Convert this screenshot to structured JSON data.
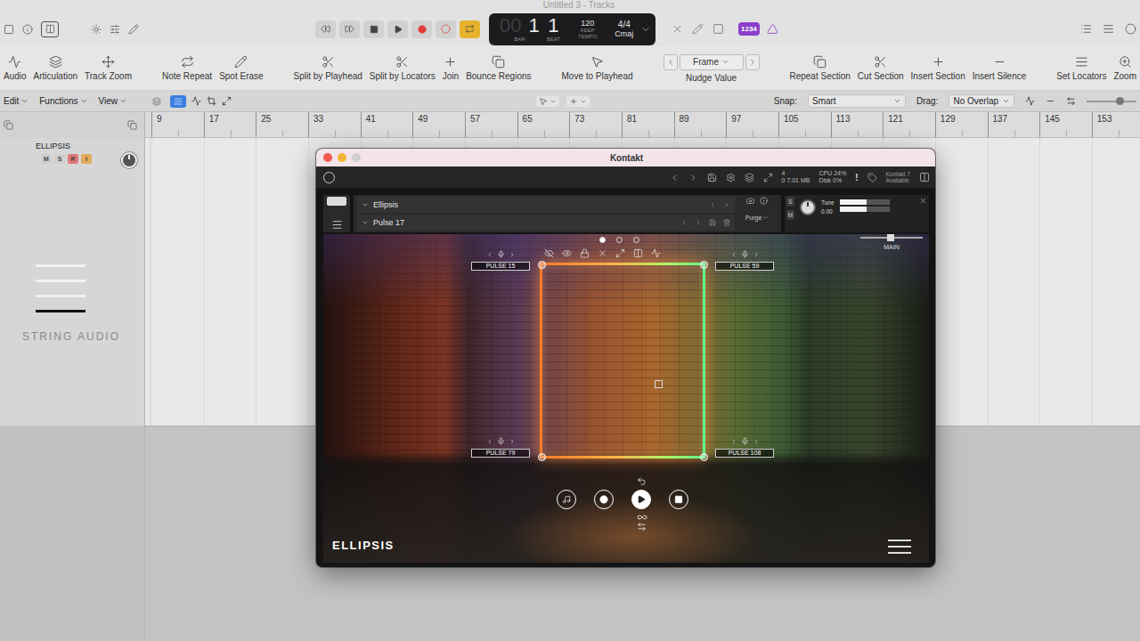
{
  "window": {
    "title": "Untitled 3 - Tracks"
  },
  "transport": {
    "bar_prefix": "00",
    "bar": "1",
    "beat": "1",
    "bar_label": "BAR",
    "beat_label": "BEAT",
    "tempo": "120",
    "tempo_mode": "KEEP",
    "tempo_label": "TEMPO",
    "signature": "4/4",
    "key": "Cmaj",
    "cycle_on": true,
    "count_in": "1234"
  },
  "toolbar": {
    "left": [
      [
        {
          "label": "Audio"
        },
        {
          "label": "Articulation"
        },
        {
          "label": "Track Zoom"
        }
      ],
      [
        {
          "label": "Note Repeat"
        },
        {
          "label": "Spot Erase"
        }
      ],
      [
        {
          "label": "Split by Playhead"
        },
        {
          "label": "Split by Locators"
        },
        {
          "label": "Join"
        },
        {
          "label": "Bounce Regions"
        }
      ],
      [
        {
          "label": "Move to Playhead"
        }
      ]
    ],
    "nudge": {
      "value": "Frame",
      "label": "Nudge Value"
    },
    "right": [
      [
        {
          "label": "Repeat Section"
        },
        {
          "label": "Cut Section"
        },
        {
          "label": "Insert Section"
        },
        {
          "label": "Insert Silence"
        }
      ],
      [
        {
          "label": "Set Locators"
        },
        {
          "label": "Zoom"
        }
      ]
    ]
  },
  "menus": [
    {
      "label": "Edit"
    },
    {
      "label": "Functions"
    },
    {
      "label": "View"
    }
  ],
  "view_modes": [
    {
      "selected": false
    },
    {
      "selected": true
    }
  ],
  "snap": {
    "label": "Snap:",
    "value": "Smart"
  },
  "drag": {
    "label": "Drag:",
    "value": "No Overlap"
  },
  "ruler": [
    "9",
    "17",
    "25",
    "33",
    "41",
    "49",
    "57",
    "65",
    "73",
    "81",
    "89",
    "97",
    "105",
    "113",
    "121",
    "129",
    "137",
    "145",
    "153"
  ],
  "tracks": [
    {
      "name": "ELLIPSIS",
      "buttons": [
        {
          "label": "M",
          "on": false,
          "color": "#cfcfcf"
        },
        {
          "label": "S",
          "on": false,
          "color": "#cfcfcf"
        },
        {
          "label": "R",
          "on": false,
          "color": "#e07a7a"
        },
        {
          "label": "I",
          "on": false,
          "color": "#e3ac5a"
        }
      ]
    }
  ],
  "logo": "STRING AUDIO",
  "plugin": {
    "title": "Kontakt",
    "status": {
      "voices": "4",
      "voices_max": "0",
      "memory": "7.01 MB",
      "cpu": "CPU 24%",
      "disk": "Disk 0%",
      "alert": "!",
      "license": "Kontakt 7",
      "license_state": "Available"
    },
    "instrument": {
      "name": "Ellipsis",
      "snapshot": "Pulse 17",
      "purge": "Purge",
      "solo": "S",
      "mute": "M",
      "tune_label": "Tune",
      "tune_value": "0.00",
      "level": 0.55,
      "output": "MAIN"
    },
    "ui": {
      "pages": [
        {
          "selected": true
        },
        {
          "selected": false
        },
        {
          "selected": false
        }
      ],
      "mics": [
        {
          "label": "PULSE 15"
        },
        {
          "label": "PULSE 59"
        },
        {
          "label": "PULSE 79"
        },
        {
          "label": "PULSE 108"
        }
      ],
      "transport": [
        {
          "kind": "note",
          "selected": false
        },
        {
          "kind": "record",
          "selected": false
        },
        {
          "kind": "play",
          "selected": true
        },
        {
          "kind": "stop",
          "selected": false
        }
      ],
      "brand": "ELLIPSIS"
    }
  }
}
